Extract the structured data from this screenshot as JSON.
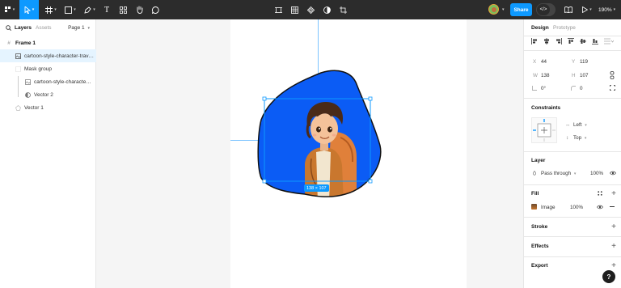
{
  "toolbar": {
    "share_label": "Share",
    "zoom_label": "190%"
  },
  "left_panel": {
    "tabs": [
      "Layers",
      "Assets"
    ],
    "page": "Page 1",
    "layers": [
      {
        "label": "Frame 1",
        "icon": "frame-icon"
      },
      {
        "label": "cartoon-style-character-trave...",
        "icon": "image-icon"
      },
      {
        "label": "Mask group",
        "icon": "mask-icon"
      },
      {
        "label": "cartoon-style-character-...",
        "icon": "image-icon"
      },
      {
        "label": "Vector 2",
        "icon": "mask-vector-icon"
      },
      {
        "label": "Vector 1",
        "icon": "vector-icon"
      }
    ]
  },
  "canvas": {
    "size_label": "138 × 107",
    "blob_color": "#0b5cf5",
    "accent": "#0d99ff"
  },
  "right_panel": {
    "tabs": [
      "Design",
      "Prototype"
    ],
    "x_label": "X",
    "x_value": "44",
    "y_label": "Y",
    "y_value": "119",
    "w_label": "W",
    "w_value": "138",
    "h_label": "H",
    "h_value": "107",
    "rotation_value": "0°",
    "radius_value": "0",
    "constraints_title": "Constraints",
    "constraint_h": "Left",
    "constraint_v": "Top",
    "layer_title": "Layer",
    "blend_mode": "Pass through",
    "layer_opacity": "100%",
    "fill_title": "Fill",
    "fill_type": "Image",
    "fill_opacity": "100%",
    "stroke_title": "Stroke",
    "effects_title": "Effects",
    "export_title": "Export"
  },
  "help_label": "?"
}
